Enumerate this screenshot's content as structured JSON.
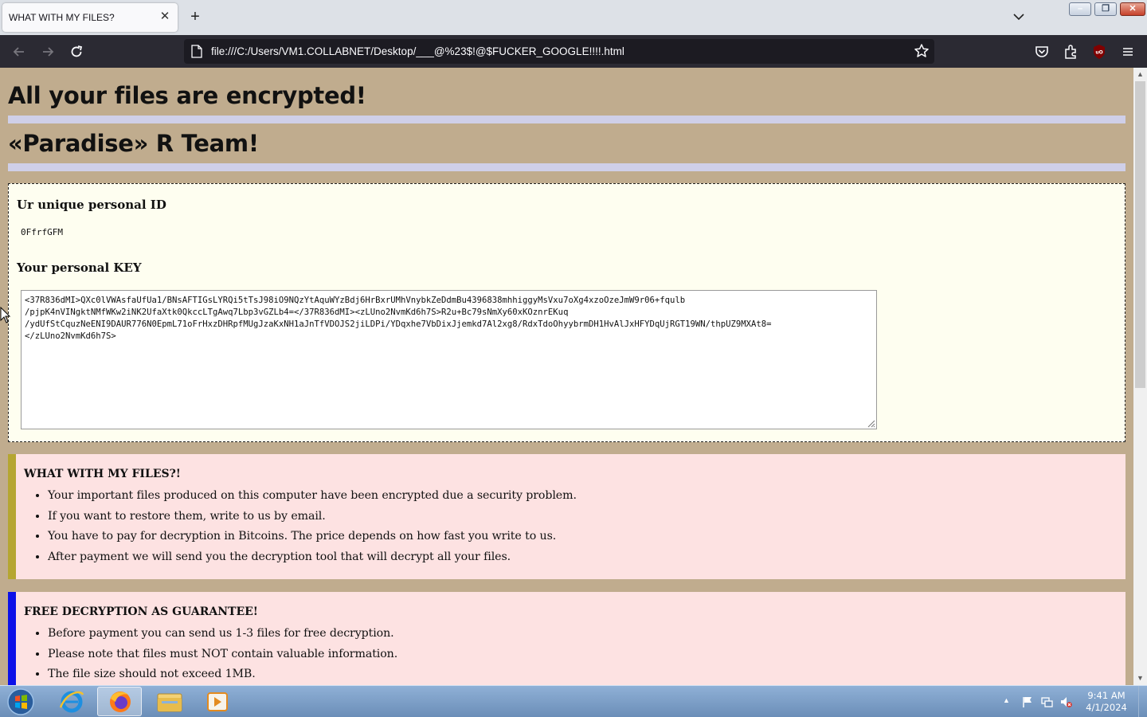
{
  "browser": {
    "tab_title": "WHAT WITH MY FILES?",
    "tab_close": "✕",
    "new_tab": "+",
    "url": "file:///C:/Users/VM1.COLLABNET/Desktop/___@%23$!@$FUCKER_GOOGLE!!!!.html"
  },
  "page": {
    "heading1": "All your files are encrypted!",
    "heading2": "«Paradise» R Team!",
    "id_label": "Ur unique personal ID",
    "id_value": "0FfrfGFM",
    "key_label": "Your personal KEY",
    "key_value": "<37R836dMI>QXc0lVWAsfaUfUa1/BNsAFTIGsLYRQi5tTsJ98iO9NQzYtAquWYzBdj6HrBxrUMhVnybkZeDdmBu4396838mhhiggyMsVxu7oXg4xzoOzeJmW9r06+fqulb\n/pjpK4nVINgktNMfWKw2iNK2UfaXtk0QkccLTgAwq7Lbp3vGZLb4=</37R836dMI><zLUno2NvmKd6h7S>R2u+Bc79sNmXy60xKOznrEKuq\n/ydUfStCquzNeENI9DAUR776N0EpmL71oFrHxzDHRpfMUgJzaKxNH1aJnTfVDOJS2jiLDPi/YDqxhe7VbDixJjemkd7Al2xg8/RdxTdoOhyybrmDH1HvAlJxHFYDqUjRGT19WN/thpUZ9MXAt8=\n</zLUno2NvmKd6h7S>",
    "note1": {
      "title": "WHAT WITH MY FILES?!",
      "items": [
        "Your important files produced on this computer have been encrypted due a security problem.",
        "If you want to restore them, write to us by email.",
        "You have to pay for decryption in Bitcoins. The price depends on how fast you write to us.",
        "After payment we will send you the decryption tool that will decrypt all your files."
      ]
    },
    "note2": {
      "title": "FREE DECRYPTION AS GUARANTEE!",
      "items": [
        "Before payment you can send us 1-3 files for free decryption.",
        "Please note that files must NOT contain valuable information.",
        "The file size should not exceed 1MB."
      ]
    }
  },
  "taskbar": {
    "time": "9:41 AM",
    "date": "4/1/2024"
  },
  "colors": {
    "page_bg": "#c0ac8e",
    "id_box_bg": "#fefef0",
    "note_bg": "#fde2e2",
    "note1_accent": "#b5a631",
    "note2_accent": "#0c11e8"
  },
  "icons": [
    "back-arrow-icon",
    "forward-arrow-icon",
    "reload-icon",
    "page-icon",
    "star-icon",
    "pocket-icon",
    "extensions-icon",
    "ublock-icon",
    "hamburger-menu-icon"
  ]
}
